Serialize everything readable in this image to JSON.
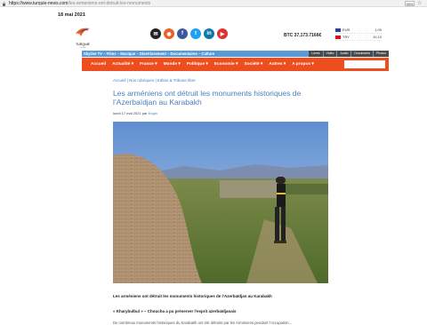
{
  "browser": {
    "url_domain": "https://www.turquie-news.com",
    "url_path": "/les-armeniens-ont-detruit-les-monuments",
    "zoom": "90%"
  },
  "header": {
    "date": "18 mai 2021",
    "logo_name": "TURQUIE",
    "logo_sub": "news",
    "btc": "BTC 37,173.7166€",
    "currencies": [
      {
        "code": "EUR",
        "value": "1,00"
      },
      {
        "code": "TRY",
        "value": "10,10"
      }
    ]
  },
  "topbar": {
    "text": "Skylive TV – Films – Musique – Divertissement – Documentaires – Culture",
    "tabs": [
      "Livres",
      "Vidéo",
      "Audio",
      "Documents",
      "Photos"
    ]
  },
  "nav": [
    "Accueil",
    "Actualité ▾",
    "France ▾",
    "Monde ▾",
    "Politique ▾",
    "Economie ▾",
    "Société ▾",
    "Autres ▾",
    "A propos ▾"
  ],
  "article": {
    "breadcrumb": "Accueil | Nos rubriques | Editos & Tribune libre",
    "title": "Les arméniens ont détruit les monuments historiques de l’Azerbaïdjan au Karabakh",
    "date": "lundi 17 mai 2021",
    "by_label": "par",
    "author": "Engin",
    "caption1": "Les arméniens ont détruit les monuments historiques de l’Azerbaïdjan au Karabakh",
    "caption2": "« Kharybulbul » – Choucha a pu préserver l’esprit azerbaïdjanais",
    "caption3": "De nombreux monuments historiques du Karabakh ont été détruits par les Arméniens pendant l’occupation..."
  }
}
